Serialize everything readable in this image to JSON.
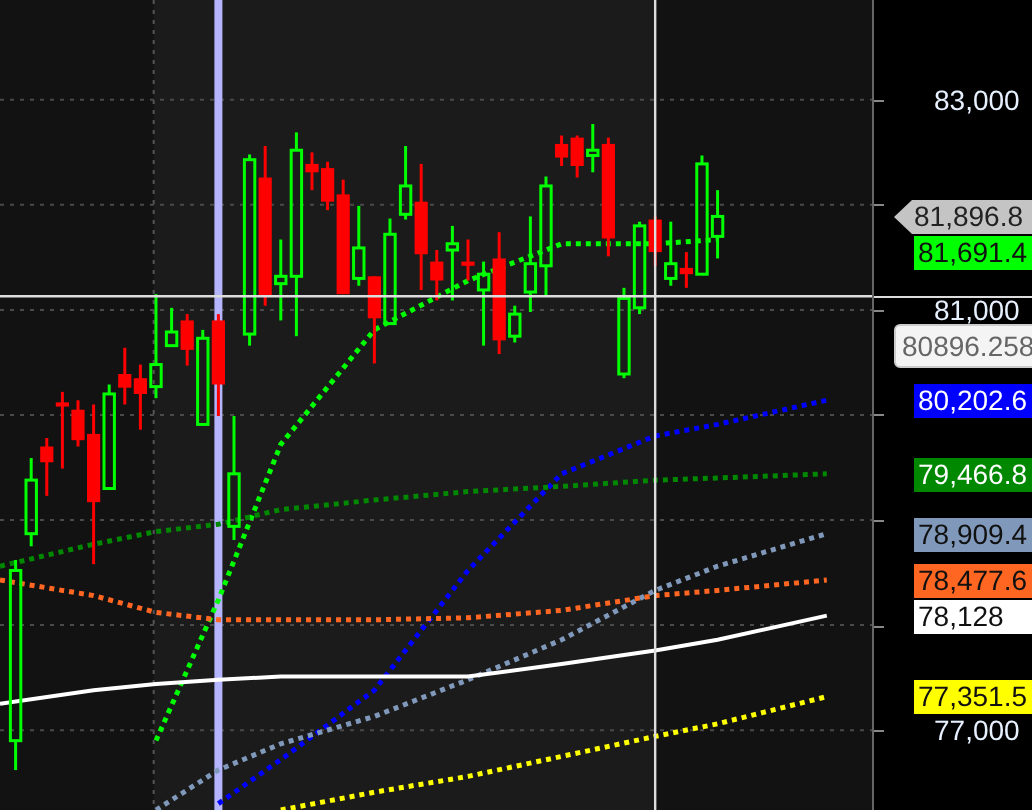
{
  "price_axis": {
    "labels": [
      "83,000",
      "81,000",
      "77,000"
    ]
  },
  "price_tags": [
    {
      "kind": "last",
      "text": "81,896.8"
    },
    {
      "kind": "line",
      "text": "81,691.4",
      "color": "#00ff00"
    },
    {
      "kind": "cursor",
      "text": "80896.258"
    },
    {
      "kind": "line",
      "text": "80,202.6",
      "color": "#0000ff"
    },
    {
      "kind": "line",
      "text": "79,466.8",
      "color": "#008800"
    },
    {
      "kind": "line",
      "text": "78,909.4",
      "color": "#8099bb"
    },
    {
      "kind": "line",
      "text": "78,477.6",
      "color": "#ff6622"
    },
    {
      "kind": "line",
      "text": "78,128",
      "color": "#ffffff"
    },
    {
      "kind": "line",
      "text": "77,351.5",
      "color": "#ffff00"
    }
  ]
}
